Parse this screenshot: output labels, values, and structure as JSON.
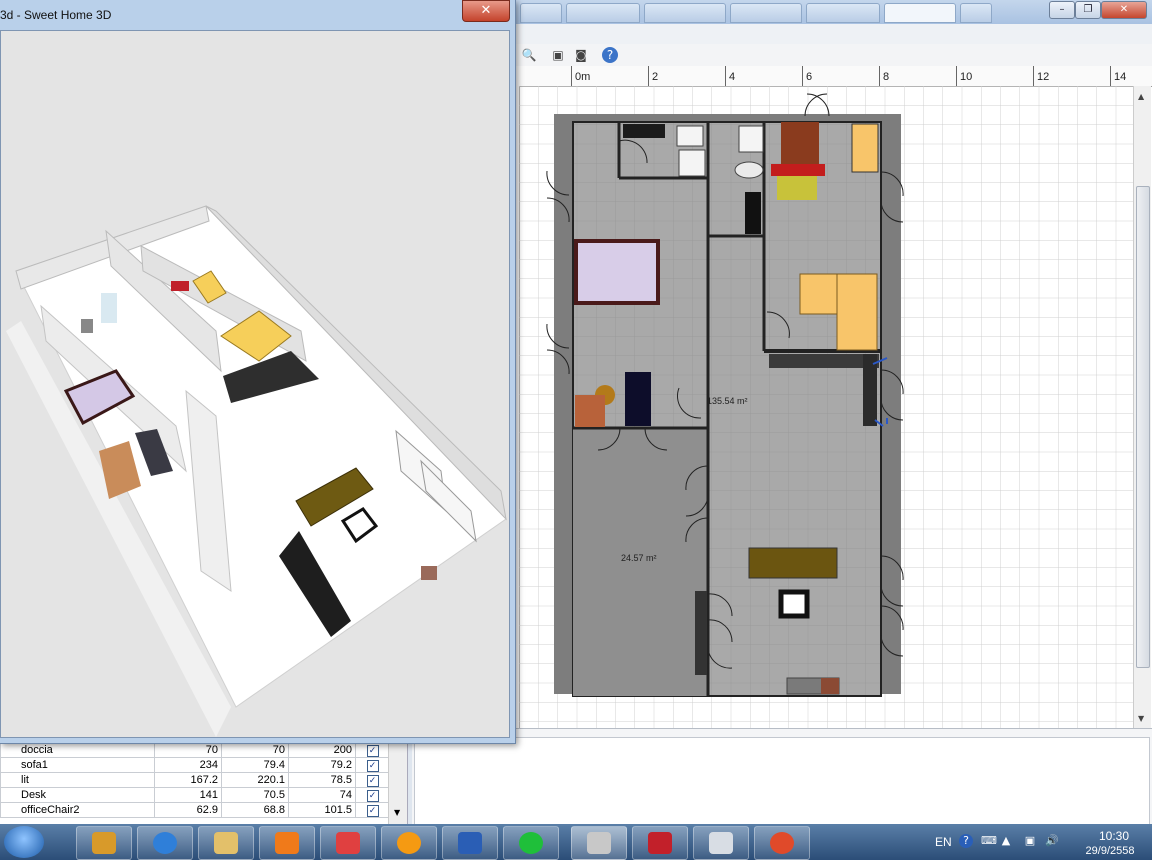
{
  "window3d": {
    "title": "3d - Sweet Home 3D",
    "close_label": "✕"
  },
  "main_window": {
    "buttons": {
      "minimize": "–",
      "restore": "❐",
      "close": "✕"
    },
    "tab_count": 9
  },
  "toolbar": {
    "icons": [
      "zoom-out-icon",
      "camera-icon",
      "create-photo-icon",
      "help-icon"
    ]
  },
  "plan": {
    "ruler_labels": [
      "0m",
      "2",
      "4",
      "6",
      "8",
      "10",
      "12",
      "14"
    ],
    "room_areas": [
      "135.54 m²",
      "24.57 m²"
    ],
    "colors": {
      "wall": "#8c8c8c",
      "floor": "#a8a8a8",
      "outside": "#7a7a7a",
      "grid": "#c8c8c8"
    }
  },
  "furniture_table": {
    "rows": [
      {
        "name": "doccia",
        "width": "70",
        "depth": "70",
        "height": "200",
        "visible": true
      },
      {
        "name": "sofa1",
        "width": "234",
        "depth": "79.4",
        "height": "79.2",
        "visible": true
      },
      {
        "name": "lit",
        "width": "167.2",
        "depth": "220.1",
        "height": "78.5",
        "visible": true
      },
      {
        "name": "Desk",
        "width": "141",
        "depth": "70.5",
        "height": "74",
        "visible": true
      },
      {
        "name": "officeChair2",
        "width": "62.9",
        "depth": "68.8",
        "height": "101.5",
        "visible": true
      }
    ]
  },
  "taskbar": {
    "apps": [
      "explorer-app",
      "internet-explorer-app",
      "file-manager-app",
      "media-player-app",
      "control-panel-app",
      "orange-app",
      "word-app",
      "line-app",
      "sweet-home-3d-app",
      "mcafee-app",
      "calculator-app",
      "chrome-app"
    ],
    "language": "EN",
    "time": "10:30",
    "date": "29/9/2558"
  }
}
